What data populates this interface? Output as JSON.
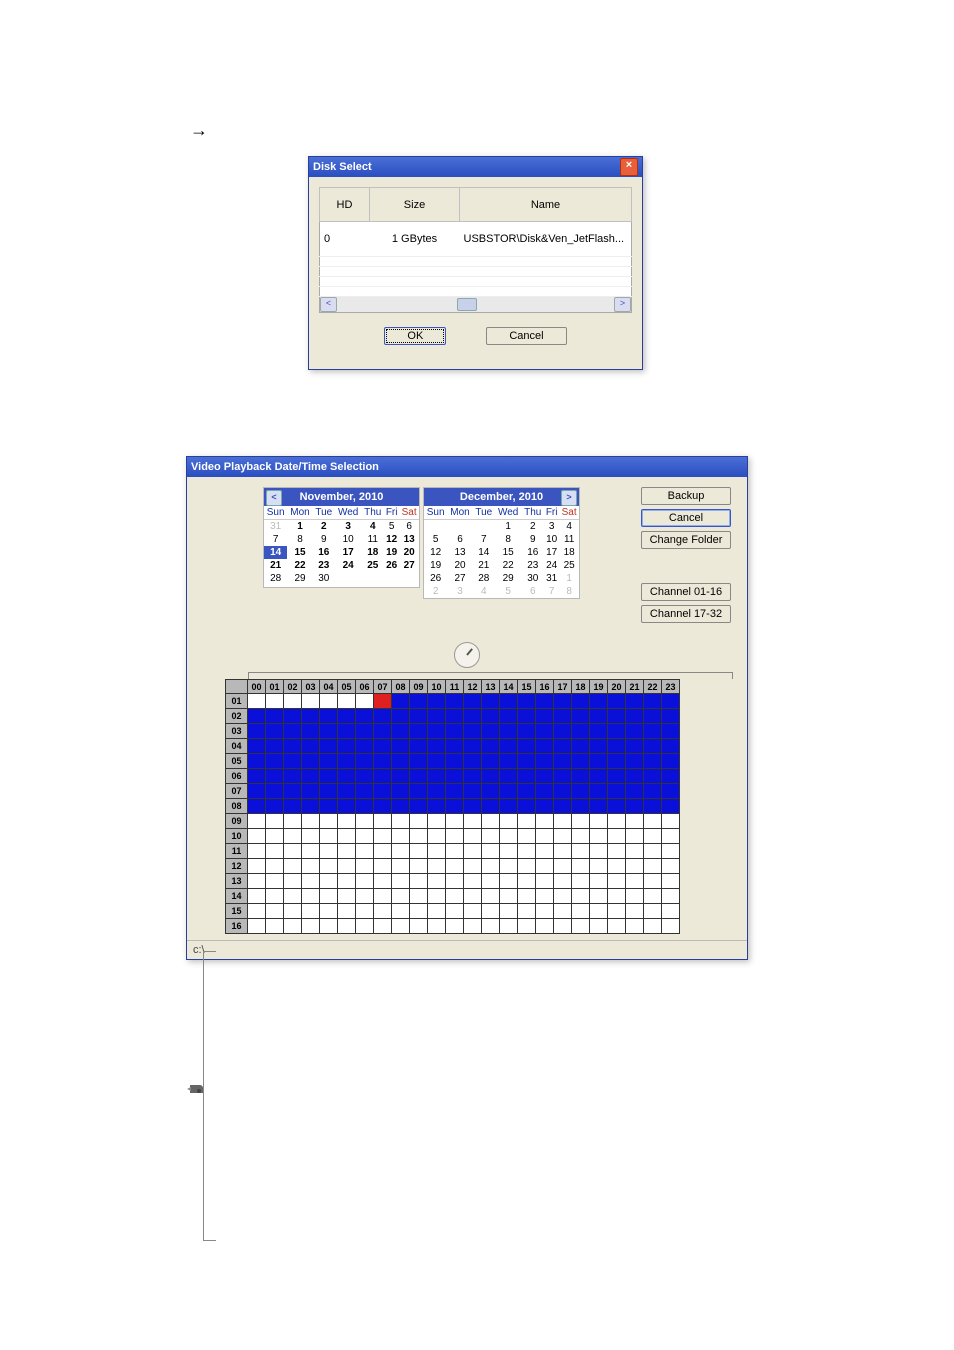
{
  "arrow": "→",
  "disk_select": {
    "title": "Disk Select",
    "columns": {
      "hd": "HD",
      "size": "Size",
      "name": "Name"
    },
    "row": {
      "hd": "0",
      "size": "1 GBytes",
      "name": "USBSTOR\\Disk&Ven_JetFlash..."
    },
    "ok": "OK",
    "cancel": "Cancel"
  },
  "playback": {
    "title": "Video Playback Date/Time Selection",
    "month_left": "November, 2010",
    "month_right": "December, 2010",
    "dow": [
      "Sun",
      "Mon",
      "Tue",
      "Wed",
      "Thu",
      "Fri",
      "Sat"
    ],
    "left_days_rows": [
      [
        {
          "d": "31",
          "c": "dim"
        },
        {
          "d": "1",
          "c": "bold"
        },
        {
          "d": "2",
          "c": "bold"
        },
        {
          "d": "3",
          "c": "bold"
        },
        {
          "d": "4",
          "c": "bold"
        },
        {
          "d": "5",
          "c": ""
        },
        {
          "d": "6",
          "c": ""
        }
      ],
      [
        {
          "d": "7",
          "c": ""
        },
        {
          "d": "8",
          "c": ""
        },
        {
          "d": "9",
          "c": ""
        },
        {
          "d": "10",
          "c": ""
        },
        {
          "d": "11",
          "c": ""
        },
        {
          "d": "12",
          "c": "bold"
        },
        {
          "d": "13",
          "c": "bold"
        }
      ],
      [
        {
          "d": "14",
          "c": "sel"
        },
        {
          "d": "15",
          "c": "bold"
        },
        {
          "d": "16",
          "c": "bold"
        },
        {
          "d": "17",
          "c": "bold"
        },
        {
          "d": "18",
          "c": "bold"
        },
        {
          "d": "19",
          "c": "bold"
        },
        {
          "d": "20",
          "c": "bold"
        }
      ],
      [
        {
          "d": "21",
          "c": "bold"
        },
        {
          "d": "22",
          "c": "bold"
        },
        {
          "d": "23",
          "c": "bold"
        },
        {
          "d": "24",
          "c": "bold"
        },
        {
          "d": "25",
          "c": "bold"
        },
        {
          "d": "26",
          "c": "bold"
        },
        {
          "d": "27",
          "c": "bold"
        }
      ],
      [
        {
          "d": "28",
          "c": ""
        },
        {
          "d": "29",
          "c": ""
        },
        {
          "d": "30",
          "c": ""
        },
        {
          "d": "",
          "c": ""
        },
        {
          "d": "",
          "c": ""
        },
        {
          "d": "",
          "c": ""
        },
        {
          "d": "",
          "c": ""
        }
      ],
      [
        {
          "d": "",
          "c": ""
        },
        {
          "d": "",
          "c": ""
        },
        {
          "d": "",
          "c": ""
        },
        {
          "d": "",
          "c": ""
        },
        {
          "d": "",
          "c": ""
        },
        {
          "d": "",
          "c": ""
        },
        {
          "d": "",
          "c": ""
        }
      ]
    ],
    "right_days_rows": [
      [
        {
          "d": "",
          "c": ""
        },
        {
          "d": "",
          "c": ""
        },
        {
          "d": "",
          "c": ""
        },
        {
          "d": "1",
          "c": ""
        },
        {
          "d": "2",
          "c": ""
        },
        {
          "d": "3",
          "c": ""
        },
        {
          "d": "4",
          "c": ""
        }
      ],
      [
        {
          "d": "5",
          "c": ""
        },
        {
          "d": "6",
          "c": ""
        },
        {
          "d": "7",
          "c": ""
        },
        {
          "d": "8",
          "c": ""
        },
        {
          "d": "9",
          "c": ""
        },
        {
          "d": "10",
          "c": ""
        },
        {
          "d": "11",
          "c": ""
        }
      ],
      [
        {
          "d": "12",
          "c": ""
        },
        {
          "d": "13",
          "c": ""
        },
        {
          "d": "14",
          "c": ""
        },
        {
          "d": "15",
          "c": ""
        },
        {
          "d": "16",
          "c": ""
        },
        {
          "d": "17",
          "c": ""
        },
        {
          "d": "18",
          "c": ""
        }
      ],
      [
        {
          "d": "19",
          "c": ""
        },
        {
          "d": "20",
          "c": ""
        },
        {
          "d": "21",
          "c": ""
        },
        {
          "d": "22",
          "c": ""
        },
        {
          "d": "23",
          "c": ""
        },
        {
          "d": "24",
          "c": ""
        },
        {
          "d": "25",
          "c": ""
        }
      ],
      [
        {
          "d": "26",
          "c": ""
        },
        {
          "d": "27",
          "c": ""
        },
        {
          "d": "28",
          "c": ""
        },
        {
          "d": "29",
          "c": ""
        },
        {
          "d": "30",
          "c": ""
        },
        {
          "d": "31",
          "c": ""
        },
        {
          "d": "1",
          "c": "dim"
        }
      ],
      [
        {
          "d": "2",
          "c": "dim"
        },
        {
          "d": "3",
          "c": "dim"
        },
        {
          "d": "4",
          "c": "dim"
        },
        {
          "d": "5",
          "c": "dim"
        },
        {
          "d": "6",
          "c": "dim"
        },
        {
          "d": "7",
          "c": "dim"
        },
        {
          "d": "8",
          "c": "dim"
        }
      ]
    ],
    "buttons": {
      "backup": "Backup",
      "cancel": "Cancel",
      "change_folder": "Change Folder",
      "ch_01_16": "Channel 01-16",
      "ch_17_32": "Channel 17-32"
    },
    "hours": [
      "00",
      "01",
      "02",
      "03",
      "04",
      "05",
      "06",
      "07",
      "08",
      "09",
      "10",
      "11",
      "12",
      "13",
      "14",
      "15",
      "16",
      "17",
      "18",
      "19",
      "20",
      "21",
      "22",
      "23"
    ],
    "channels": [
      "01",
      "02",
      "03",
      "04",
      "05",
      "06",
      "07",
      "08",
      "09",
      "10",
      "11",
      "12",
      "13",
      "14",
      "15",
      "16"
    ],
    "red_cell": {
      "channel": "01",
      "hour": "07"
    },
    "empty_start_hour_ch01": "00",
    "status_path": "c:\\"
  }
}
